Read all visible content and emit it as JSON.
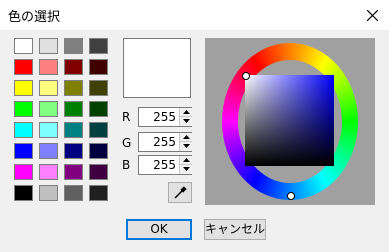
{
  "window": {
    "title": "色の選択"
  },
  "swatches": {
    "rows": [
      [
        "#ffffff",
        "#e0e0e0",
        "#808080",
        "#404040"
      ],
      [
        "#ff0000",
        "#ff8080",
        "#800000",
        "#400000"
      ],
      [
        "#ffff00",
        "#ffff80",
        "#808000",
        "#404000"
      ],
      [
        "#00ff00",
        "#80ff80",
        "#008000",
        "#004000"
      ],
      [
        "#00ffff",
        "#80ffff",
        "#008080",
        "#004040"
      ],
      [
        "#0000ff",
        "#8080ff",
        "#000080",
        "#000040"
      ],
      [
        "#ff00ff",
        "#ff80ff",
        "#800080",
        "#400040"
      ],
      [
        "#000000",
        "#c0c0c0",
        "#606060",
        "#202020"
      ]
    ]
  },
  "preview": {
    "color": "#ffffff"
  },
  "rgb": {
    "r_label": "R",
    "r_value": "255",
    "g_label": "G",
    "g_value": "255",
    "b_label": "B",
    "b_value": "255"
  },
  "buttons": {
    "ok": "OK",
    "cancel": "キャンセル"
  }
}
